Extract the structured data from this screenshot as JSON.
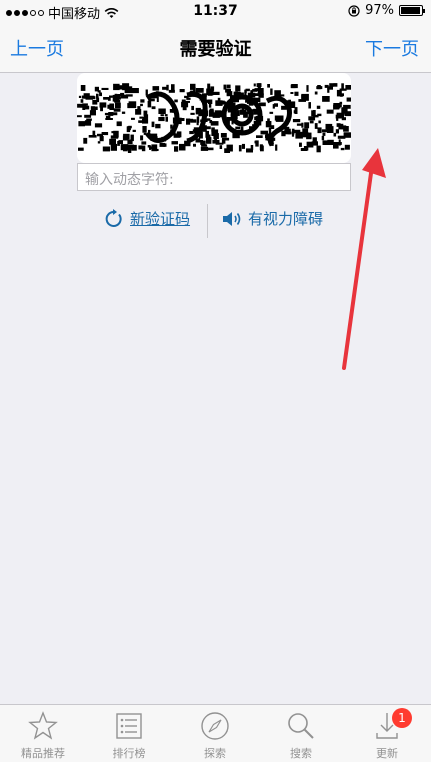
{
  "status_bar": {
    "carrier": "中国移动",
    "time": "11:37",
    "battery": "97%",
    "battery_level": 0.97,
    "signal_bars": 3,
    "signal_total": 5
  },
  "nav": {
    "prev_label": "上一页",
    "title": "需要验证",
    "next_label": "下一页"
  },
  "form": {
    "input_placeholder": "输入动态字符:",
    "refresh_label": "新验证码",
    "audio_label": "有视力障碍"
  },
  "tabbar": {
    "items": [
      {
        "label": "精品推荐",
        "icon": "star-icon"
      },
      {
        "label": "排行榜",
        "icon": "list-icon"
      },
      {
        "label": "探索",
        "icon": "compass-icon"
      },
      {
        "label": "搜索",
        "icon": "search-icon"
      },
      {
        "label": "更新",
        "icon": "download-icon",
        "badge": "1"
      }
    ]
  },
  "colors": {
    "accent": "#1a7ae0",
    "link": "#1a6aa8",
    "badge": "#ff3b30",
    "arrow": "#e8343c"
  }
}
